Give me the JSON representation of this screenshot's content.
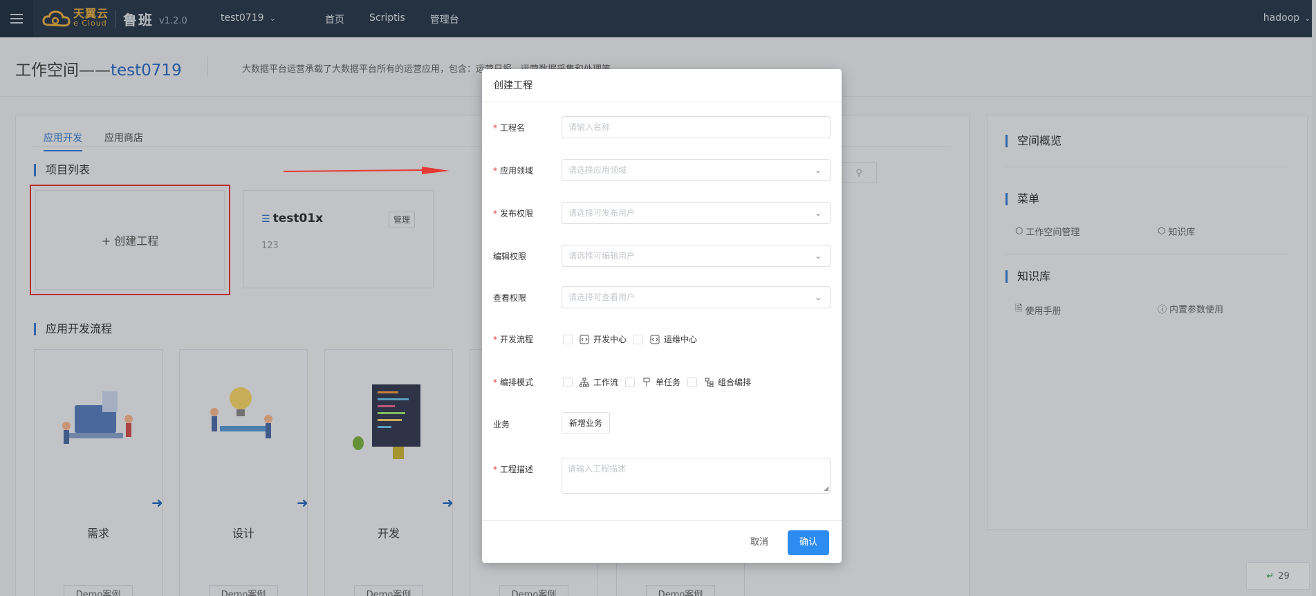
{
  "topbar": {
    "brand_cn": "天翼云",
    "brand_en": "e Cloud",
    "product": "鲁班",
    "version": "v1.2.0",
    "workspace": "test0719",
    "nav": [
      "首页",
      "Scriptis",
      "管理台"
    ],
    "user": "hadoop"
  },
  "header": {
    "title_prefix": "工作空间——",
    "title_workspace": "test0719",
    "description": "大数据平台运营承载了大数据平台所有的运营应用，包含：运营日报、运营数据采集和处理等"
  },
  "main": {
    "tabs": [
      "应用开发",
      "应用商店"
    ],
    "project_list_title": "项目列表",
    "create_project_label": "+ 创建工程",
    "projects": [
      {
        "name": "test01x",
        "manage_label": "管理",
        "description": "123"
      }
    ],
    "flow_title": "应用开发流程",
    "flow_steps": [
      {
        "label": "需求",
        "demo": "Demo案例"
      },
      {
        "label": "设计",
        "demo": "Demo案例"
      },
      {
        "label": "开发",
        "demo": "Demo案例"
      },
      {
        "label": "",
        "demo": "Demo案例"
      },
      {
        "label": "",
        "demo": "Demo案例"
      }
    ]
  },
  "right_panel": {
    "overview_title": "空间概览",
    "menu_title": "菜单",
    "menu_items": [
      "工作空间管理",
      "知识库"
    ],
    "kb_title": "知识库",
    "kb_items": [
      "使用手册",
      "内置参数使用"
    ]
  },
  "floating_badge": {
    "count": "29"
  },
  "modal": {
    "title": "创建工程",
    "fields": {
      "name": {
        "label": "工程名",
        "placeholder": "请输入名称"
      },
      "domain": {
        "label": "应用领域",
        "placeholder": "请选择应用领域"
      },
      "publish": {
        "label": "发布权限",
        "placeholder": "请选择可发布用户"
      },
      "edit": {
        "label": "编辑权限",
        "placeholder": "请选择可编辑用户"
      },
      "view": {
        "label": "查看权限",
        "placeholder": "请选择可查看用户"
      },
      "dev_flow": {
        "label": "开发流程",
        "options": [
          "开发中心",
          "运维中心"
        ]
      },
      "orchestration": {
        "label": "编排模式",
        "options": [
          "工作流",
          "单任务",
          "组合编排"
        ]
      },
      "business": {
        "label": "业务",
        "button": "新增业务"
      },
      "description": {
        "label": "工程描述",
        "placeholder": "请输入工程描述"
      }
    },
    "cancel_label": "取消",
    "confirm_label": "确认"
  },
  "colors": {
    "topbar_bg": "#2c3e50",
    "accent": "#2d6cc4",
    "primary_button": "#2d8cf0",
    "required": "#e53935",
    "highlight_box": "#e53935"
  }
}
